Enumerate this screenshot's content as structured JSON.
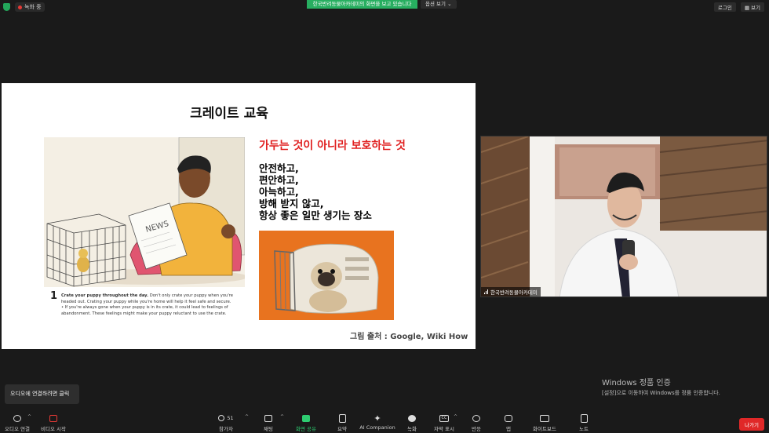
{
  "topbar": {
    "recording": "녹화 중",
    "share_banner": "한국반려동물아카데미의 화면을 보고 있습니다",
    "view_options": "옵션 보기",
    "login": "로그인",
    "view": "보기"
  },
  "slide": {
    "title": "크레이트 교육",
    "headline": "가두는 것이 아니라 보호하는 것",
    "lines": [
      "안전하고,",
      "편안하고,",
      "아늑하고,",
      "방해 받지 않고,",
      "항상 좋은 일만 생기는 장소"
    ],
    "caption_num": "1",
    "caption_bold": "Crate your puppy throughout the day.",
    "caption_text": " Don't only crate your puppy when you're headed out. Crating your puppy while you're home will help it feel safe and secure.",
    "caption_bullet": "• If you're always gone when your puppy is in its crate, it could lead to feelings of abandonment. These feelings might make your puppy reluctant to use the crate.",
    "credit": "그림 출처 : Google, Wiki How"
  },
  "video": {
    "participant_name": "한국반려동물아카데미"
  },
  "watermark": {
    "line1": "Windows 정품 인증",
    "line2": "[설정]으로 이동하여 Windows를 정품 인증합니다."
  },
  "tooltip": "오디오에 연결하려면 클릭",
  "toolbar": {
    "audio": "오디오 연결",
    "video": "비디오 시작",
    "participants": "참가자",
    "participants_count": "51",
    "chat": "채팅",
    "share": "화면 공유",
    "summary": "요약",
    "ai": "AI Companion",
    "record": "녹화",
    "captions": "자막 표시",
    "reactions": "반응",
    "apps": "앱",
    "whiteboard": "화이트보드",
    "notes": "노트",
    "leave": "나가기"
  },
  "colors": {
    "banner_green": "#27ae60",
    "headline_red": "#e02020",
    "leave_red": "#e02828"
  }
}
